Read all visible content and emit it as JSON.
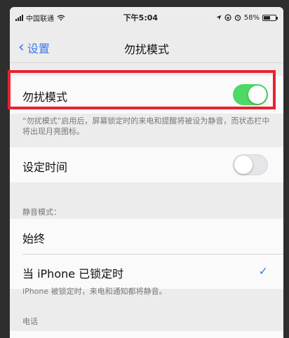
{
  "status_bar": {
    "carrier": "中国联通",
    "time": "下午5:04",
    "battery": "58%"
  },
  "nav": {
    "back_label": "设置",
    "title": "勿扰模式"
  },
  "dnd": {
    "label": "勿扰模式",
    "toggle_on": true,
    "description": "“勿扰模式”启用后，屏幕锁定时的来电和提醒将被设为静音，而状态栏中将出现月亮图标。"
  },
  "scheduled": {
    "label": "设定时间",
    "toggle_on": false
  },
  "silence": {
    "header": "静音模式：",
    "options": [
      "始终",
      "当 iPhone 已锁定时"
    ],
    "footnote": "iPhone 被锁定时，来电和通知都将静音。"
  },
  "phone": {
    "header": "电话"
  },
  "colors": {
    "accent": "#3478f6",
    "toggle_on": "#4cd964",
    "highlight": "#e8232f"
  }
}
